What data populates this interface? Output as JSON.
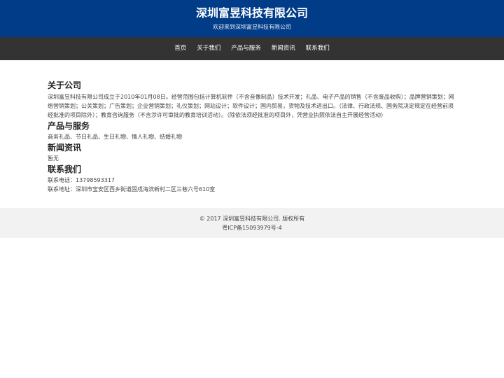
{
  "header": {
    "title": "深圳富昱科技有限公司",
    "subtitle": "欢迎来到深圳富昱科技有限公司"
  },
  "nav": {
    "items": [
      "首页",
      "关于我们",
      "产品与服务",
      "新闻资讯",
      "联系我们"
    ]
  },
  "about": {
    "title": "关于公司",
    "text": "深圳富昱科技有限公司成立于2010年01月08日。经营范围包括计算机软件（不含音像制品）技术开发；礼品、电子产品的销售（不含废品收购）；品牌营销策划；网络营销策划；公关策划；广告策划；企业营销策划；礼仪策划；网站设计；软件设计；国内贸易，货物及技术进出口。（法律、行政法规、国务院决定规定在经营前须经批准的项目除外）；教育咨询服务（不含涉许可审批的教育培训活动）。（除依法须经批准的项目外，凭营业执照依法自主开展经营活动）"
  },
  "products": {
    "title": "产品与服务",
    "text": "商务礼品、节日礼品、生日礼物、情人礼物、结婚礼物"
  },
  "news": {
    "title": "新闻资讯",
    "text": "暂无"
  },
  "contact": {
    "title": "联系我们",
    "phone": "联系电话：13798593317",
    "address": "联系地址：深圳市宝安区西乡街道固戍海滨新村二区三巷六号610室"
  },
  "footer": {
    "copyright": "© 2017 深圳富昱科技有限公司. 版权所有",
    "icp": "粤ICP备15093979号-4"
  }
}
